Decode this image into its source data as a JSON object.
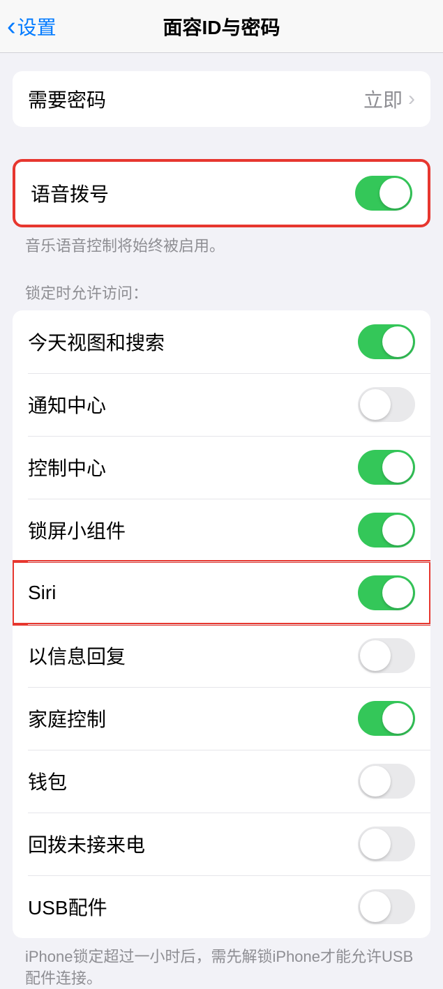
{
  "header": {
    "back_label": "设置",
    "title": "面容ID与密码"
  },
  "passcode_group": {
    "require_label": "需要密码",
    "require_value": "立即"
  },
  "voice_dial": {
    "label": "语音拨号",
    "enabled": true,
    "footer": "音乐语音控制将始终被启用。"
  },
  "lock_section": {
    "header": "锁定时允许访问：",
    "items": [
      {
        "label": "今天视图和搜索",
        "enabled": true
      },
      {
        "label": "通知中心",
        "enabled": false
      },
      {
        "label": "控制中心",
        "enabled": true
      },
      {
        "label": "锁屏小组件",
        "enabled": true
      },
      {
        "label": "Siri",
        "enabled": true,
        "highlighted": true
      },
      {
        "label": "以信息回复",
        "enabled": false
      },
      {
        "label": "家庭控制",
        "enabled": true
      },
      {
        "label": "钱包",
        "enabled": false
      },
      {
        "label": "回拨未接来电",
        "enabled": false
      },
      {
        "label": "USB配件",
        "enabled": false
      }
    ],
    "footer": "iPhone锁定超过一小时后，需先解锁iPhone才能允许USB配件连接。"
  }
}
